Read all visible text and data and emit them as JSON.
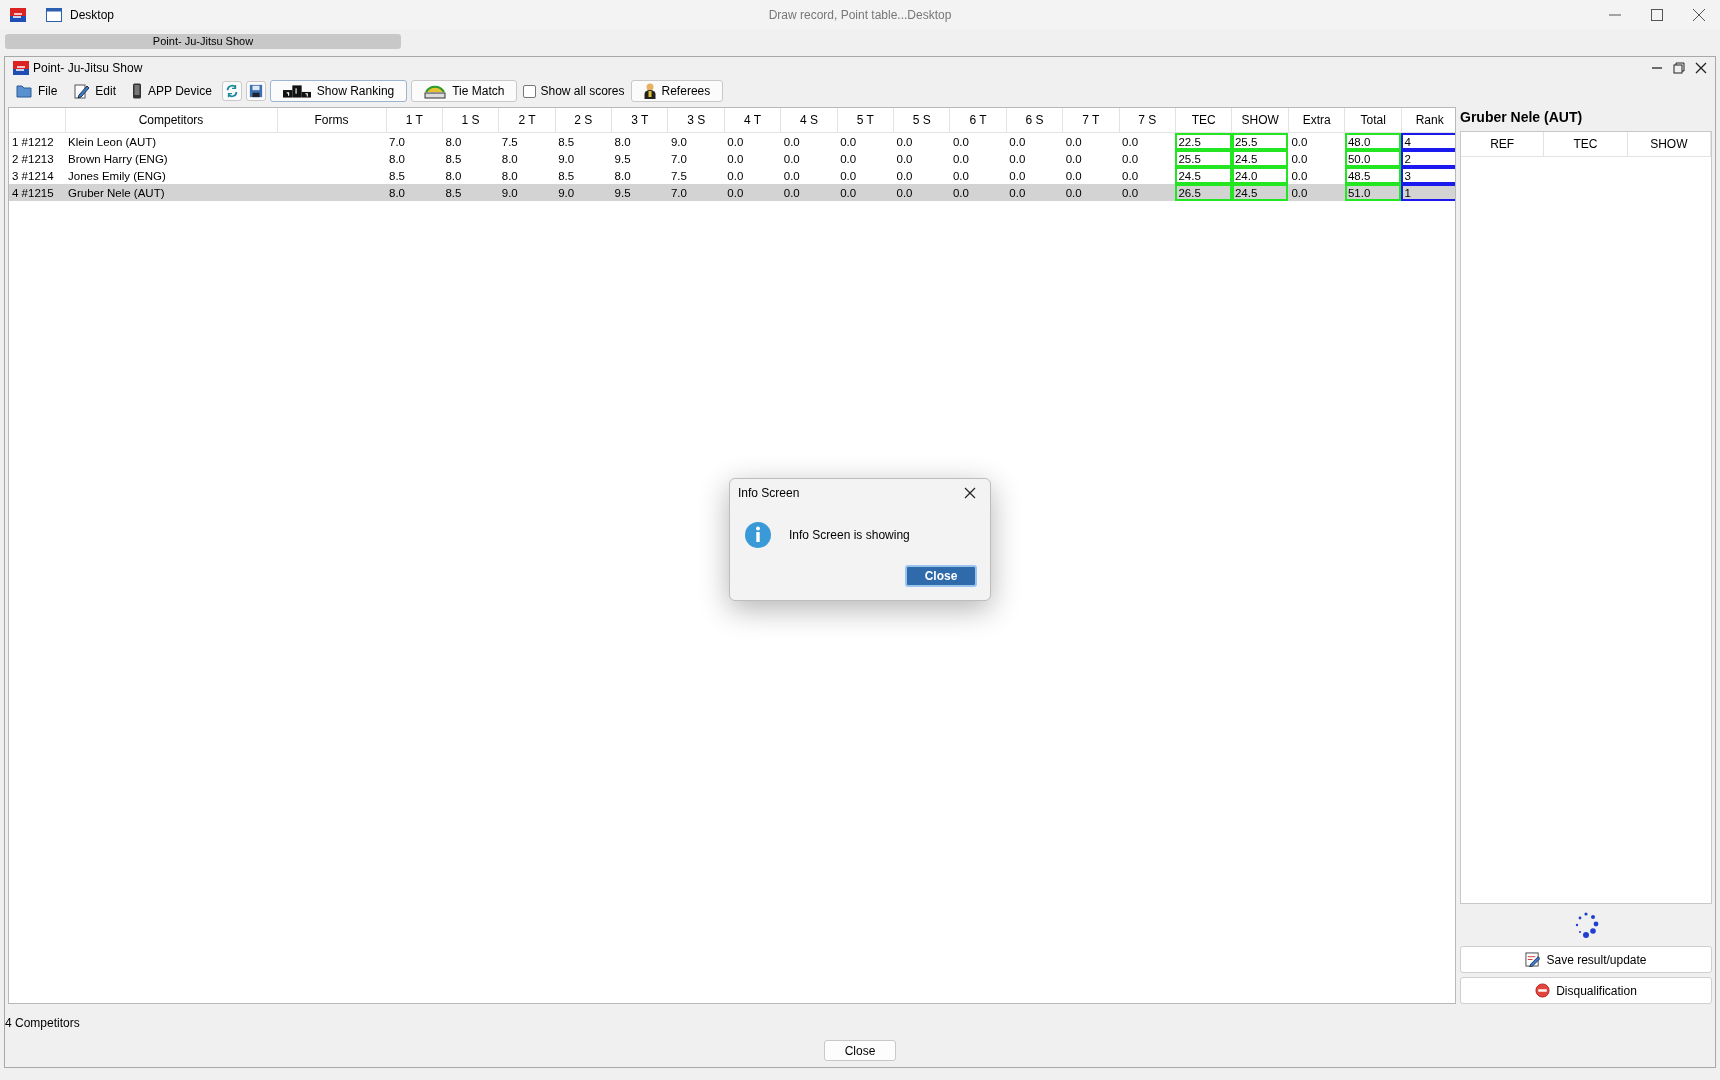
{
  "window": {
    "title": "Desktop",
    "caption": "Draw record, Point table...Desktop"
  },
  "tabs": [
    {
      "label": "Point- Ju-Jitsu Show",
      "selected": true
    }
  ],
  "document": {
    "title": "Point- Ju-Jitsu Show"
  },
  "toolbar": [
    {
      "kind": "file",
      "label": "File"
    },
    {
      "kind": "edit",
      "label": "Edit"
    },
    {
      "kind": "device",
      "label": "APP Device"
    },
    {
      "kind": "refresh"
    },
    {
      "kind": "save"
    },
    {
      "kind": "ranking",
      "label": "Show Ranking"
    },
    {
      "kind": "tie",
      "label": "Tie Match"
    },
    {
      "kind": "checkbox",
      "label": "Show all scores",
      "checked": false
    },
    {
      "kind": "referees",
      "label": "Referees"
    }
  ],
  "table": {
    "columns": [
      {
        "label": "Competitors"
      },
      {
        "label": "Forms"
      },
      {
        "label": "1 T"
      },
      {
        "label": "1 S"
      },
      {
        "label": "2 T"
      },
      {
        "label": "2 S"
      },
      {
        "label": "3 T"
      },
      {
        "label": "3 S"
      },
      {
        "label": "4 T"
      },
      {
        "label": "4 S"
      },
      {
        "label": "5 T"
      },
      {
        "label": "5 S"
      },
      {
        "label": "6 T"
      },
      {
        "label": "6 S"
      },
      {
        "label": "7 T"
      },
      {
        "label": "7 S"
      },
      {
        "label": "TEC",
        "color": "#22e622"
      },
      {
        "label": "SHOW",
        "color": "#22e622"
      },
      {
        "label": "Extra"
      },
      {
        "label": "Total",
        "color": "#22e622"
      },
      {
        "label": "Rank",
        "color": "#1a1aee"
      }
    ],
    "rows": [
      {
        "no": "1 #1212",
        "selected": false,
        "cells": [
          "Klein Leon (AUT)",
          "",
          "7.0",
          "8.0",
          "7.5",
          "8.5",
          "8.0",
          "9.0",
          "0.0",
          "0.0",
          "0.0",
          "0.0",
          "0.0",
          "0.0",
          "0.0",
          "0.0",
          "22.5",
          "25.5",
          "0.0",
          "48.0",
          "4"
        ]
      },
      {
        "no": "2 #1213",
        "selected": false,
        "cells": [
          "Brown Harry (ENG)",
          "",
          "8.0",
          "8.5",
          "8.0",
          "9.0",
          "9.5",
          "7.0",
          "0.0",
          "0.0",
          "0.0",
          "0.0",
          "0.0",
          "0.0",
          "0.0",
          "0.0",
          "25.5",
          "24.5",
          "0.0",
          "50.0",
          "2"
        ]
      },
      {
        "no": "3 #1214",
        "selected": false,
        "cells": [
          "Jones Emily (ENG)",
          "",
          "8.5",
          "8.0",
          "8.0",
          "8.5",
          "8.0",
          "7.5",
          "0.0",
          "0.0",
          "0.0",
          "0.0",
          "0.0",
          "0.0",
          "0.0",
          "0.0",
          "24.5",
          "24.0",
          "0.0",
          "48.5",
          "3"
        ]
      },
      {
        "no": "4 #1215",
        "selected": true,
        "cells": [
          "Gruber Nele (AUT)",
          "",
          "8.0",
          "8.5",
          "9.0",
          "9.0",
          "9.5",
          "7.0",
          "0.0",
          "0.0",
          "0.0",
          "0.0",
          "0.0",
          "0.0",
          "0.0",
          "0.0",
          "26.5",
          "24.5",
          "0.0",
          "51.0",
          "1"
        ]
      }
    ]
  },
  "detail": {
    "title": "Gruber Nele (AUT)",
    "columns": [
      "REF",
      "TEC",
      "SHOW"
    ],
    "buttons": [
      {
        "kind": "save",
        "label": "Save result/update"
      },
      {
        "kind": "disqualify",
        "label": "Disqualification"
      }
    ]
  },
  "status": "4 Competitors",
  "close_button": "Close",
  "dialog": {
    "title": "Info Screen",
    "message": "Info Screen is showing",
    "button": "Close"
  }
}
